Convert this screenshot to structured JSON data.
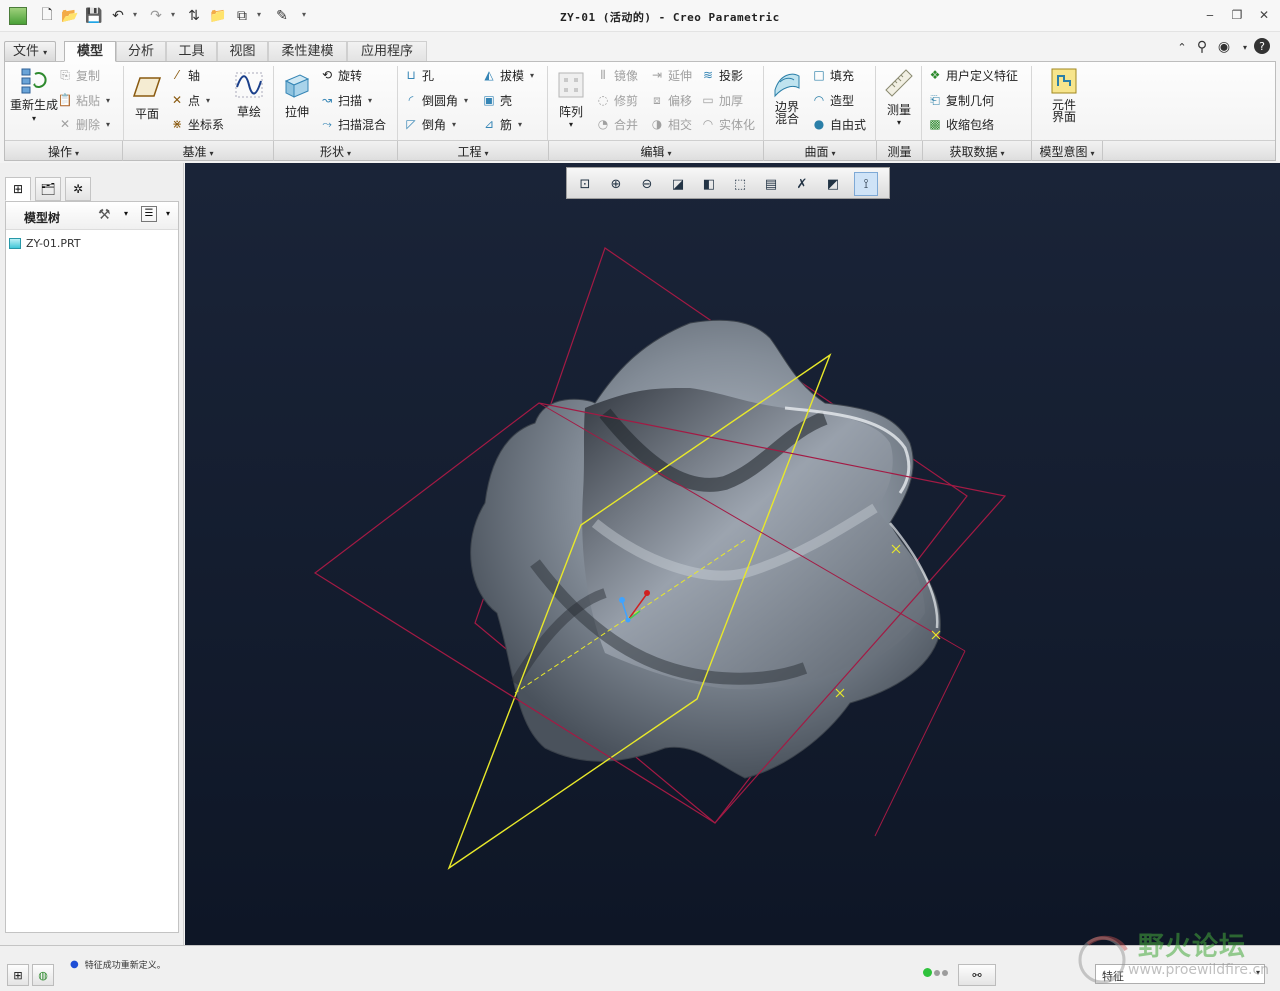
{
  "window": {
    "title": "ZY-01 (活动的) - Creo Parametric"
  },
  "tabs": [
    {
      "label": "文件"
    },
    {
      "label": "模型"
    },
    {
      "label": "分析"
    },
    {
      "label": "工具"
    },
    {
      "label": "视图"
    },
    {
      "label": "柔性建模"
    },
    {
      "label": "应用程序"
    }
  ],
  "ribbon": {
    "operations": {
      "regenerate": "重新生成",
      "copy": "复制",
      "paste": "粘贴",
      "delete": "删除",
      "group_label": "操作"
    },
    "datum": {
      "plane": "平面",
      "axis": "轴",
      "point": "点",
      "csys": "坐标系",
      "sketch": "草绘",
      "group_label": "基准"
    },
    "shapes": {
      "extrude": "拉伸",
      "revolve": "旋转",
      "sweep": "扫描",
      "swept_blend": "扫描混合",
      "group_label": "形状"
    },
    "engineering": {
      "hole": "孔",
      "round": "倒圆角",
      "chamfer": "倒角",
      "draft": "拔模",
      "shell": "壳",
      "rib": "筋",
      "group_label": "工程"
    },
    "editing": {
      "pattern": "阵列",
      "mirror": "镜像",
      "trim": "修剪",
      "merge": "合并",
      "extend": "延伸",
      "offset": "偏移",
      "intersect": "相交",
      "project": "投影",
      "thicken": "加厚",
      "solidify": "实体化",
      "group_label": "编辑"
    },
    "surfaces": {
      "boundary_blend": "边界混合",
      "fill": "填充",
      "style": "造型",
      "freestyle": "自由式",
      "group_label": "曲面"
    },
    "measure": {
      "measure": "测量",
      "group_label": "测量"
    },
    "get_data": {
      "udf": "用户定义特征",
      "copy_geometry": "复制几何",
      "shrinkwrap": "收缩包络",
      "group_label": "获取数据"
    },
    "model_intent": {
      "component_interface": "元件界面",
      "group_label": "模型意图"
    }
  },
  "model_tree": {
    "title": "模型树",
    "items": [
      {
        "label": "ZY-01.PRT"
      }
    ]
  },
  "status": {
    "message": "特征成功重新定义。",
    "filter_value": "特征"
  },
  "watermark": {
    "title": "野火论坛",
    "url": "www.proewildfire.cn"
  },
  "colors": {
    "background_top": "#1a2438",
    "background_bottom": "#0e1626",
    "datum_plane_selected": "#e8e82a",
    "datum_plane": "#a31a44",
    "model_surface": "#8a939e"
  }
}
